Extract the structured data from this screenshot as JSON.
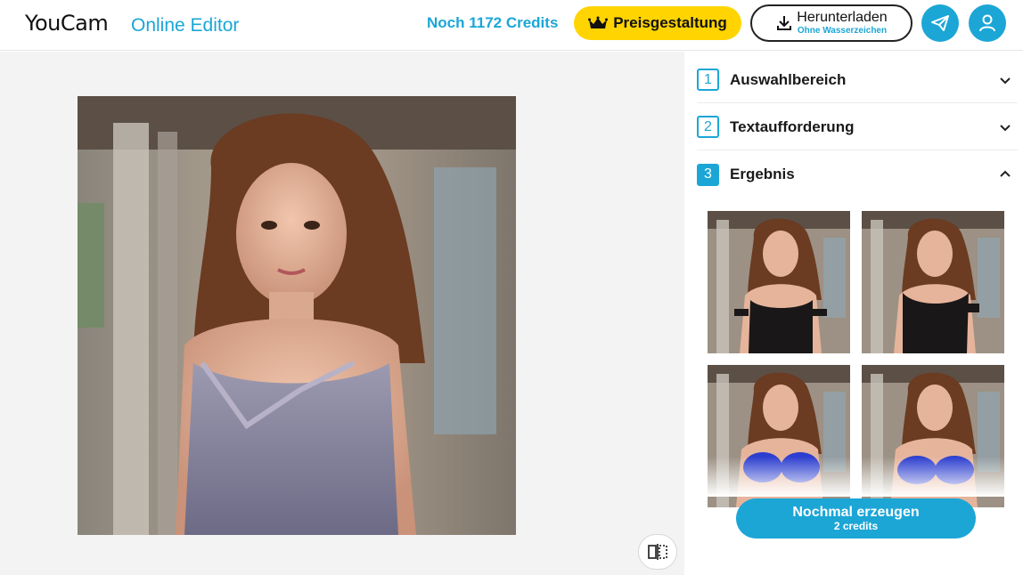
{
  "header": {
    "brand": "YouCam",
    "brand_sub": "Online Editor",
    "credits_text": "Noch 1172 Credits",
    "pricing_label": "Preisgestaltung",
    "download_label": "Herunterladen",
    "download_sub": "Ohne Wasserzeichen",
    "send_icon": "paper-plane-icon",
    "user_icon": "user-icon",
    "accent_color": "#1ba6d6",
    "pricing_color": "#ffd400"
  },
  "panel": {
    "steps": [
      {
        "number": "1",
        "label": "Auswahlbereich",
        "state": "collapsed"
      },
      {
        "number": "2",
        "label": "Textaufforderung",
        "state": "collapsed"
      },
      {
        "number": "3",
        "label": "Ergebnis",
        "state": "expanded"
      }
    ],
    "results": [
      {
        "outfit": "black corset"
      },
      {
        "outfit": "black corset"
      },
      {
        "outfit": "blue bikini"
      },
      {
        "outfit": "blue bikini"
      }
    ],
    "regenerate_label": "Nochmal erzeugen",
    "regenerate_cost": "2 credits"
  },
  "canvas": {
    "compare_icon": "compare-split-icon"
  }
}
